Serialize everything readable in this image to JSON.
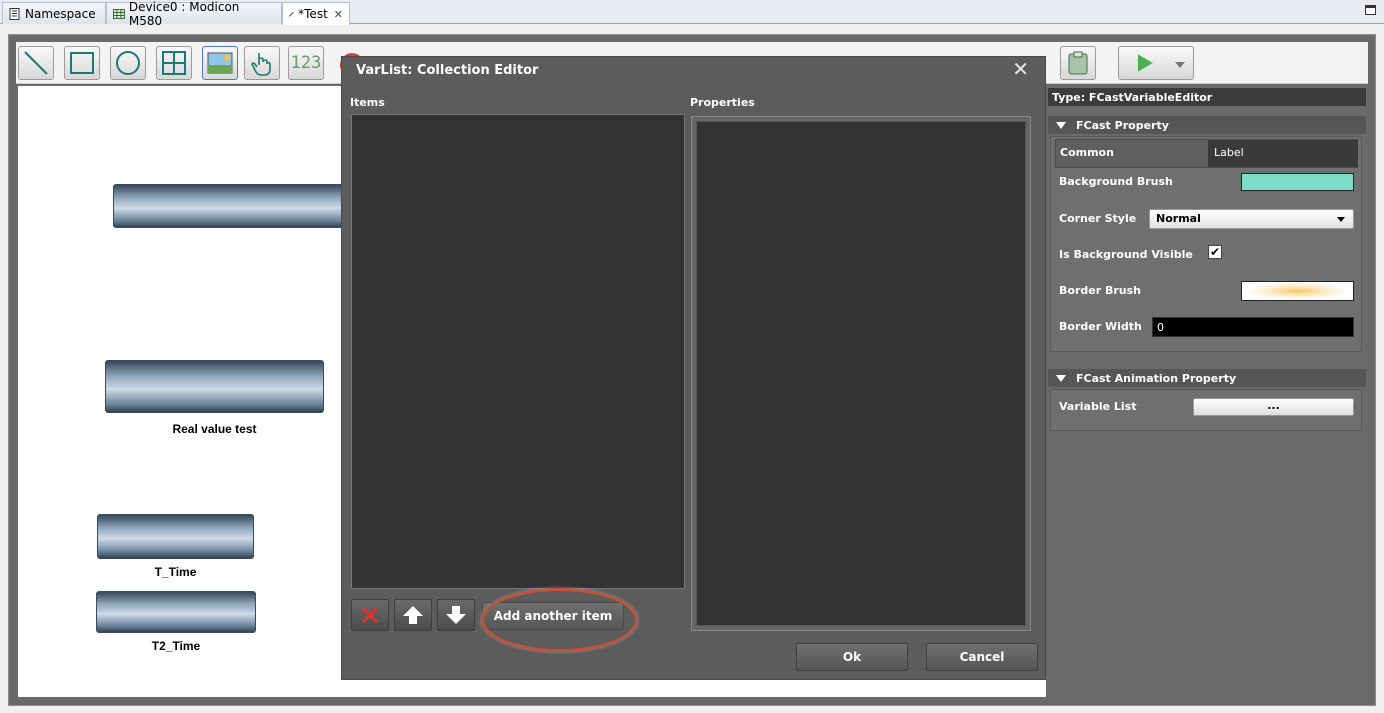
{
  "tabs": [
    {
      "label": "Namespace",
      "icon": "namespace-icon"
    },
    {
      "label": "Device0 : Modicon M580",
      "icon": "table-icon"
    },
    {
      "label": "*Test",
      "icon": "pencil-icon",
      "active": true
    }
  ],
  "toolbar": {
    "number_tool_text": "123"
  },
  "canvas": {
    "labels": {
      "real_value": "Real value test",
      "t_time": "T_Time",
      "t2_time": "T2_Time"
    }
  },
  "dialog": {
    "title": "VarList: Collection Editor",
    "items_label": "Items",
    "properties_label": "Properties",
    "add_label": "Add another item",
    "ok_label": "Ok",
    "cancel_label": "Cancel"
  },
  "properties": {
    "type_title": "Type: FCastVariableEditor",
    "section1_title": "FCast Property",
    "common_label": "Common",
    "common_value": "Label",
    "background_brush_label": "Background Brush",
    "background_brush_color": "#7fdcc6",
    "corner_style_label": "Corner Style",
    "corner_style_value": "Normal",
    "is_bg_visible_label": "Is Background Visible",
    "is_bg_visible_checked": true,
    "border_brush_label": "Border Brush",
    "border_width_label": "Border Width",
    "border_width_value": "0",
    "section2_title": "FCast Animation Property",
    "variable_list_label": "Variable List",
    "variable_list_button": "..."
  },
  "colors": {
    "accent_red": "#c0533a",
    "panel_gray": "#5c5c5c",
    "list_dark": "#333333"
  }
}
